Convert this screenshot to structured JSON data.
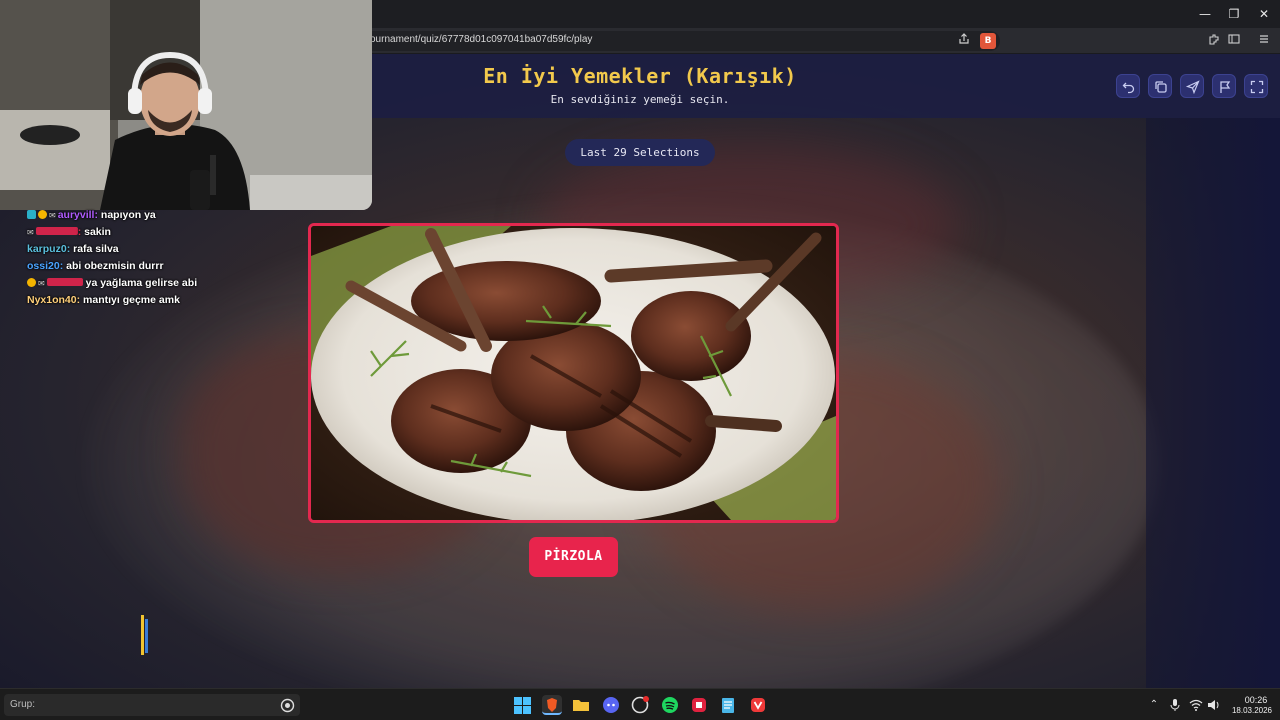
{
  "browser": {
    "url": "ournament/quiz/67778d01c097041ba07d59fc/play",
    "window_controls": [
      "—",
      "❐",
      "✕"
    ]
  },
  "quiz": {
    "title": "En İyi Yemekler (Karışık)",
    "subtitle": "En sevdiğiniz yemeği seçin.",
    "selections_label": "Last 29 Selections",
    "answer_label": "PİRZOLA"
  },
  "chat": {
    "messages": [
      {
        "user": "auryvill",
        "text": "napıyon ya",
        "color": "#b05cff"
      },
      {
        "user": "",
        "text": "sakin",
        "color": "#e0344f"
      },
      {
        "user": "karpuz0",
        "text": "rafa silva",
        "color": "#5bc0de"
      },
      {
        "user": "ossi20",
        "text": "abi obezmisin durrr",
        "color": "#4aa3ff"
      },
      {
        "user": "",
        "text": "ya yağlama gelirse abi",
        "color": "#e0344f"
      },
      {
        "user": "Nyx1on40",
        "text": "mantıyı geçme amk",
        "color": "#ffd07a"
      }
    ]
  },
  "taskbar": {
    "search_placeholder": "Grup:",
    "time": "00:26",
    "date": "18.03.2026"
  },
  "colors": {
    "accent": "#e8244c",
    "title": "#f2c94c",
    "header_bg": "#1c1e42"
  }
}
